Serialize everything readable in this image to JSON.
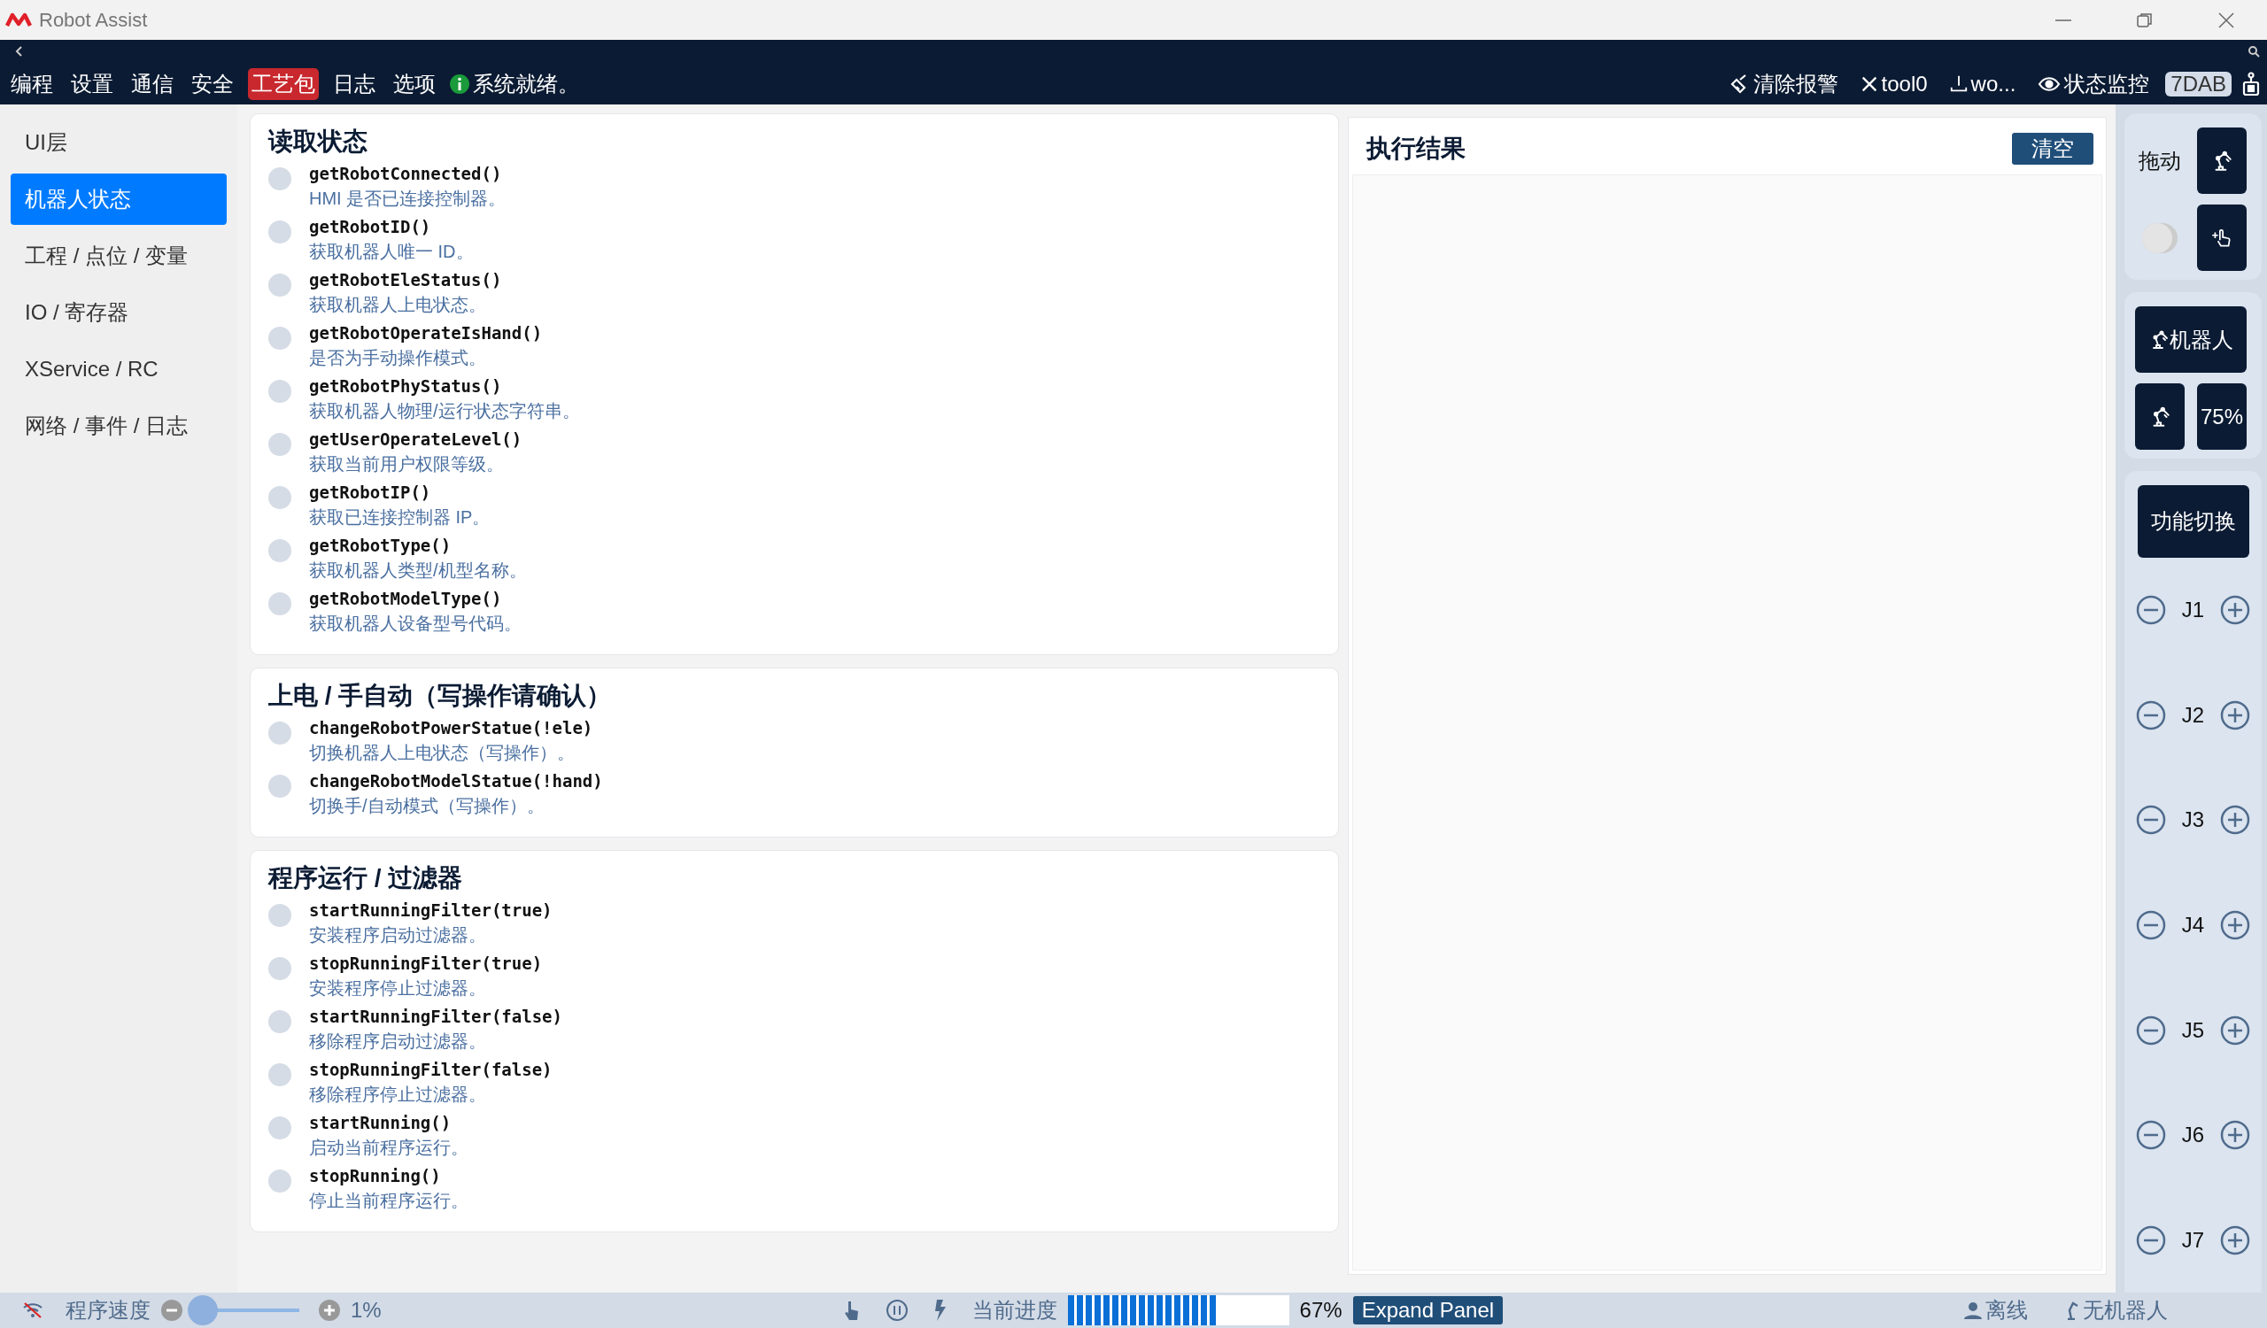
{
  "window": {
    "title": "Robot Assist"
  },
  "nav": {
    "menu": [
      {
        "label": "编程",
        "selected": false
      },
      {
        "label": "设置",
        "selected": false
      },
      {
        "label": "通信",
        "selected": false
      },
      {
        "label": "安全",
        "selected": false
      },
      {
        "label": "工艺包",
        "selected": true
      },
      {
        "label": "日志",
        "selected": false
      },
      {
        "label": "选项",
        "selected": false
      }
    ],
    "status": "系统就绪。",
    "actions": [
      {
        "kind": "clear",
        "label": "清除报警"
      },
      {
        "kind": "tool",
        "label": "tool0"
      },
      {
        "kind": "workpiece",
        "label": "wo..."
      },
      {
        "kind": "monitor",
        "label": "状态监控"
      }
    ],
    "badge": "7DAB"
  },
  "sidebar": {
    "items": [
      {
        "label": "UI层",
        "selected": false
      },
      {
        "label": "机器人状态",
        "selected": true
      },
      {
        "label": "工程 / 点位 / 变量",
        "selected": false
      },
      {
        "label": "IO / 寄存器",
        "selected": false
      },
      {
        "label": "XService / RC",
        "selected": false
      },
      {
        "label": "网络 / 事件 / 日志",
        "selected": false
      }
    ]
  },
  "sections": [
    {
      "title": "读取状态",
      "items": [
        {
          "func": "getRobotConnected()",
          "desc": "HMI 是否已连接控制器。",
          "selected": false
        },
        {
          "func": "getRobotID()",
          "desc": "获取机器人唯一 ID。",
          "selected": false
        },
        {
          "func": "getRobotEleStatus()",
          "desc": "获取机器人上电状态。",
          "selected": false
        },
        {
          "func": "getRobotOperateIsHand()",
          "desc": "是否为手动操作模式。",
          "selected": false
        },
        {
          "func": "getRobotPhyStatus()",
          "desc": "获取机器人物理/运行状态字符串。",
          "selected": false
        },
        {
          "func": "getUserOperateLevel()",
          "desc": "获取当前用户权限等级。",
          "selected": false
        },
        {
          "func": "getRobotIP()",
          "desc": "获取已连接控制器 IP。",
          "selected": false
        },
        {
          "func": "getRobotType()",
          "desc": "获取机器人类型/机型名称。",
          "selected": false
        },
        {
          "func": "getRobotModelType()",
          "desc": "获取机器人设备型号代码。",
          "selected": false
        }
      ]
    },
    {
      "title": "上电 / 手自动（写操作请确认）",
      "items": [
        {
          "func": "changeRobotPowerStatue(!ele)",
          "desc": "切换机器人上电状态（写操作）。",
          "selected": false
        },
        {
          "func": "changeRobotModelStatue(!hand)",
          "desc": "切换手/自动模式（写操作）。",
          "selected": false
        }
      ]
    },
    {
      "title": "程序运行 / 过滤器",
      "items": [
        {
          "func": "startRunningFilter(true)",
          "desc": "安装程序启动过滤器。",
          "selected": false
        },
        {
          "func": "stopRunningFilter(true)",
          "desc": "安装程序停止过滤器。",
          "selected": false
        },
        {
          "func": "startRunningFilter(false)",
          "desc": "移除程序启动过滤器。",
          "selected": false
        },
        {
          "func": "stopRunningFilter(false)",
          "desc": "移除程序停止过滤器。",
          "selected": false
        },
        {
          "func": "startRunning()",
          "desc": "启动当前程序运行。",
          "selected": false
        },
        {
          "func": "stopRunning()",
          "desc": "停止当前程序运行。",
          "selected": false
        }
      ]
    }
  ],
  "result": {
    "title": "执行结果",
    "clear_button": "清空"
  },
  "side_panel": {
    "drag_label": "拖动",
    "drag_toggle": {
      "on": false
    },
    "robot_button": "机器人",
    "speed_button": "75%",
    "switch_button": "功能切换",
    "joints": [
      "J1",
      "J2",
      "J3",
      "J4",
      "J5",
      "J6",
      "J7"
    ]
  },
  "status_bar": {
    "speed_label": "程序速度",
    "speed_slider": {
      "level": 0.01
    },
    "speed_value": "1%",
    "progress_label": "当前进度",
    "progress": {
      "level": 0.67
    },
    "progress_value": "67%",
    "expand_button": "Expand Panel",
    "connection": "离线",
    "robot": "无机器人"
  }
}
